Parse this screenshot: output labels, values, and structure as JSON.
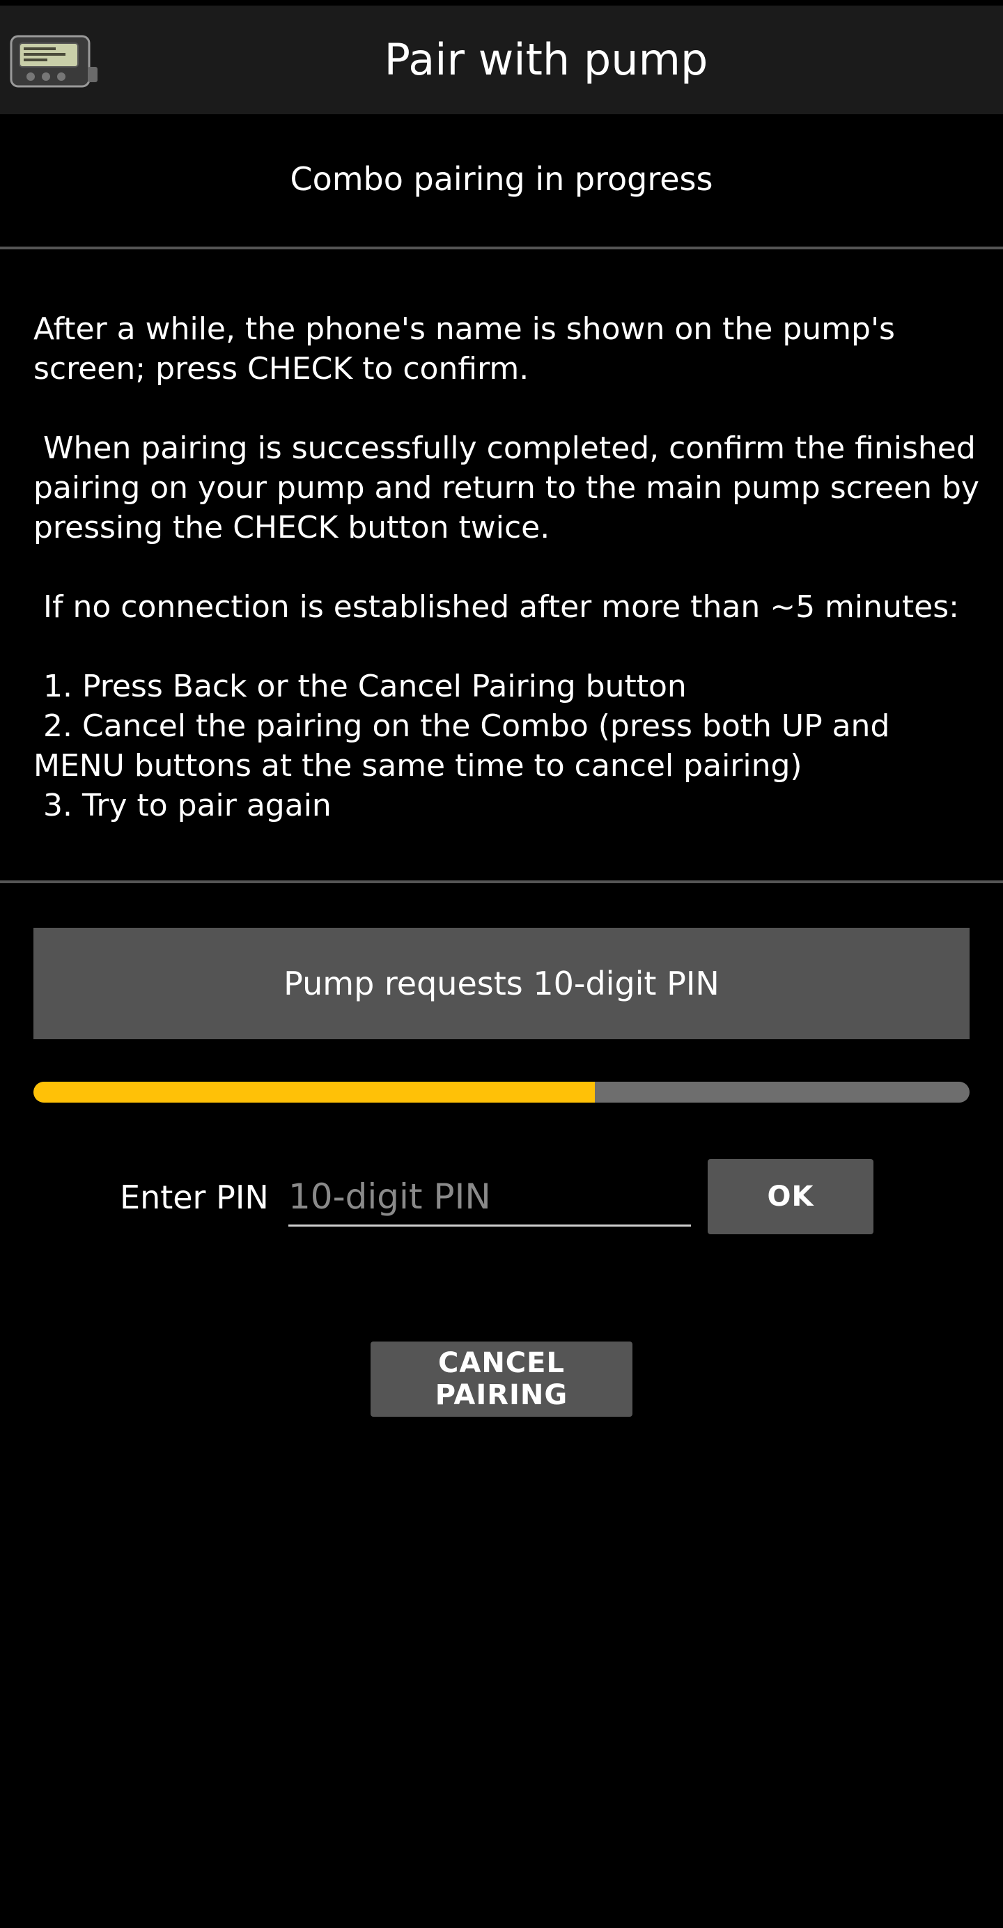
{
  "app_bar": {
    "title": "Pair with pump",
    "icon": "insulin-pump-icon"
  },
  "status": {
    "text": "Combo pairing in progress"
  },
  "instructions": {
    "paragraph_1": "After a while, the phone's name is shown on the pump's screen; press CHECK to confirm.",
    "paragraph_2": " When pairing is successfully completed, confirm the finished pairing on your pump and return to the main pump screen by pressing the CHECK button twice.",
    "paragraph_3": " If no connection is established after more than ~5 minutes:",
    "steps": [
      " 1. Press Back or the Cancel Pairing button",
      " 2. Cancel the pairing on the Combo (press both UP and MENU buttons at the same time to cancel pairing)",
      " 3. Try to pair again"
    ]
  },
  "pin_request": {
    "banner": "Pump requests 10-digit PIN",
    "progress_fraction": 0.6,
    "label": "Enter PIN",
    "input_value": "",
    "input_placeholder": "10-digit PIN",
    "ok_label": "OK"
  },
  "cancel": {
    "label": "CANCEL PAIRING"
  },
  "colors": {
    "background": "#000000",
    "app_bar": "#1b1b1b",
    "button": "#555555",
    "progress_fill": "#ffc107",
    "progress_track": "#6e6e6e"
  }
}
